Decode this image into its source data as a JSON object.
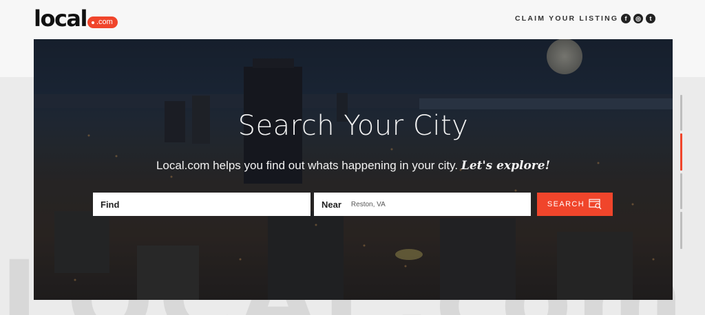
{
  "header": {
    "logo_word": "local",
    "logo_badge": ".com",
    "claim_link": "CLAIM YOUR LISTING",
    "social": [
      {
        "icon": "facebook-icon",
        "glyph": "f"
      },
      {
        "icon": "instagram-icon",
        "glyph": "◎"
      },
      {
        "icon": "twitter-icon",
        "glyph": "t"
      }
    ]
  },
  "background_text": "LOCAL.com",
  "hero": {
    "title": "Search Your City",
    "subtitle": "Local.com helps you find out whats happening in your city.",
    "subtitle_emphasis": "Let's explore!",
    "find_label": "Find",
    "find_value": "",
    "near_label": "Near",
    "near_value": "Reston, VA",
    "search_label": "SEARCH"
  },
  "colors": {
    "accent": "#f0452b",
    "text_dark": "#111111",
    "page_bg": "#ebebeb"
  }
}
